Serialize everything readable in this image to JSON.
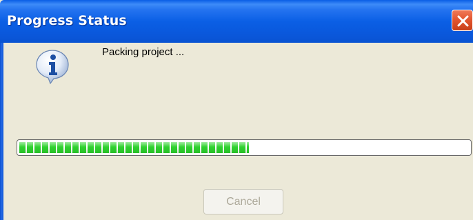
{
  "window": {
    "title": "Progress Status"
  },
  "message": {
    "text": "Packing project ..."
  },
  "progress": {
    "fraction": 0.51,
    "color": "#2fd22f"
  },
  "buttons": {
    "cancel_label": "Cancel",
    "cancel_enabled": false
  },
  "icons": {
    "close": "close-icon",
    "info": "info-icon"
  },
  "colors": {
    "titlebar": "#0a5ee6",
    "close_button": "#e35630",
    "dialog_background": "#ece9d8"
  }
}
